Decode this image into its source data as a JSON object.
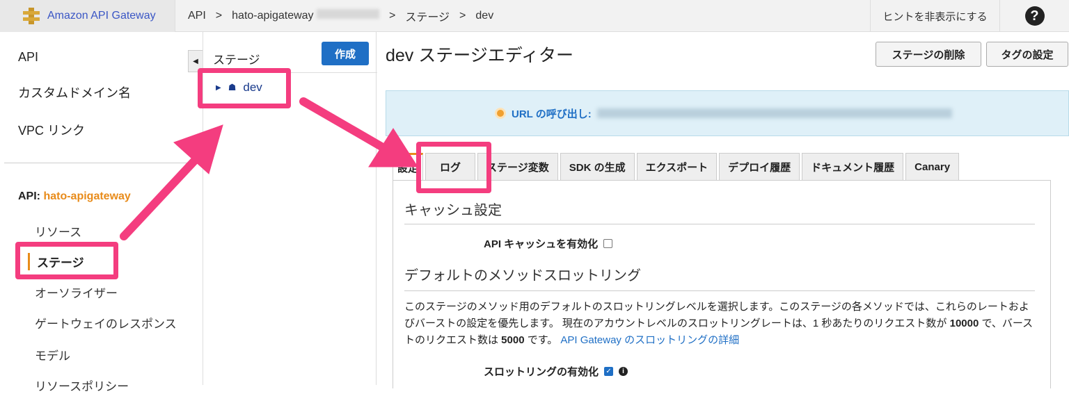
{
  "header": {
    "brand": "Amazon API Gateway",
    "crumbs": [
      "API",
      ">",
      "hato-apigateway",
      ">",
      "ステージ",
      ">",
      "dev"
    ],
    "hint": "ヒントを非表示にする",
    "help": "?"
  },
  "sidebar": {
    "top": [
      "API",
      "カスタムドメイン名",
      "VPC リンク"
    ],
    "api_label": "API:",
    "api_name": "hato-apigateway",
    "items": [
      "リソース",
      "ステージ",
      "オーソライザー",
      "ゲートウェイのレスポンス",
      "モデル",
      "リソースポリシー"
    ]
  },
  "stages": {
    "title": "ステージ",
    "create": "作成",
    "node": "dev"
  },
  "main": {
    "title": "dev ステージエディター",
    "delete": "ステージの削除",
    "tags": "タグの設定",
    "url_label": "URL の呼び出し:",
    "tabs": [
      "設定",
      "ログ",
      "ステージ変数",
      "SDK の生成",
      "エクスポート",
      "デプロイ履歴",
      "ドキュメント履歴",
      "Canary"
    ],
    "cache_heading": "キャッシュ設定",
    "cache_label": "API キャッシュを有効化",
    "throttle_heading": "デフォルトのメソッドスロットリング",
    "desc1": "このステージのメソッド用のデフォルトのスロットリングレベルを選択します。このステージの各メソッドでは、これらのレートおよびバーストの設定を優先します。 現在のアカウントレベルのスロットリングレートは、1 秒あたりのリクエスト数が ",
    "rate": "10000",
    "desc2": " で、バーストのリクエスト数は ",
    "burst": "5000",
    "desc3": " です。 ",
    "link": "API Gateway のスロットリングの詳細",
    "throttle_label": "スロットリングの有効化"
  },
  "colors": {
    "highlight": "#f43d7f",
    "accent": "#e88b1a",
    "primary": "#1f6fc5"
  }
}
